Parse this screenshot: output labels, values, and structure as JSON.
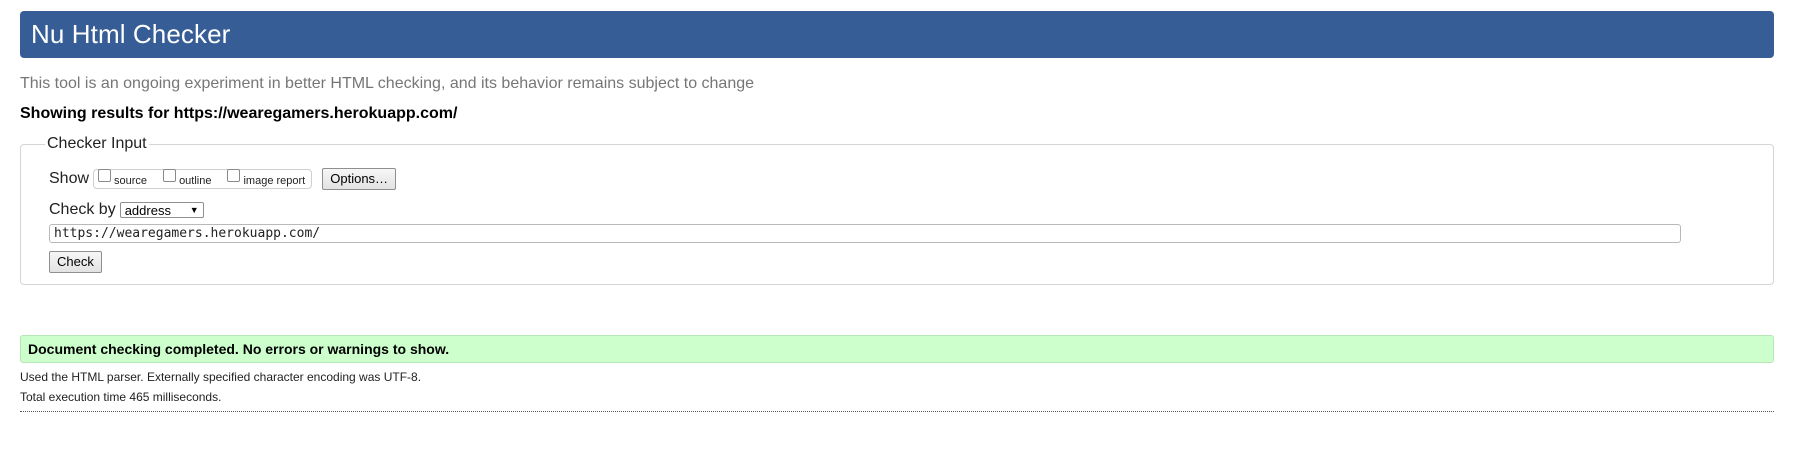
{
  "header": {
    "title": "Nu Html Checker"
  },
  "tagline": "This tool is an ongoing experiment in better HTML checking, and its behavior remains subject to change",
  "results_for": "Showing results for https://wearegamers.herokuapp.com/",
  "form": {
    "legend": "Checker Input",
    "show_label": "Show",
    "options": [
      {
        "label": "source",
        "checked": false
      },
      {
        "label": "outline",
        "checked": false
      },
      {
        "label": "image report",
        "checked": false
      }
    ],
    "options_button": "Options…",
    "check_by_label": "Check by",
    "check_by_value": "address",
    "url_value": "https://wearegamers.herokuapp.com/",
    "check_button": "Check"
  },
  "result": {
    "success_message": "Document checking completed. No errors or warnings to show.",
    "parser_info": "Used the HTML parser. Externally specified character encoding was UTF-8.",
    "execution_time": "Total execution time 465 milliseconds."
  },
  "colors": {
    "header_bg": "#365d95",
    "success_bg": "#ccffcc"
  }
}
